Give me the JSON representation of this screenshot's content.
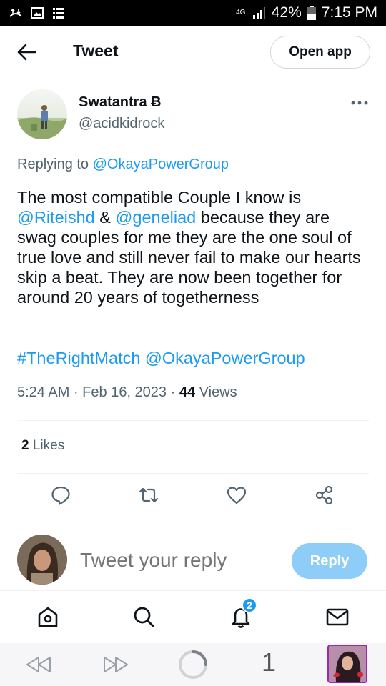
{
  "status_bar": {
    "network": "4G",
    "battery": "42%",
    "time": "7:15 PM"
  },
  "header": {
    "title": "Tweet",
    "open_app_label": "Open app"
  },
  "tweet": {
    "author_name": "Swatantra Ƀ",
    "author_handle": "@acidkidrock",
    "replying_prefix": "Replying to",
    "replying_to": "@OkayaPowerGroup",
    "body_part1": "The most compatible Couple I know is",
    "mention1": "@Riteishd",
    "amp": "&",
    "mention2": "@geneliad",
    "body_part2": "because they are swag couples for me they are the one soul of true love and still never fail to make our hearts skip a beat. They are now been together for around 20 years of togetherness",
    "hashtag": "#TheRightMatch",
    "hashtag_mention": "@OkayaPowerGroup",
    "time": "5:24 AM",
    "date": "Feb 16, 2023",
    "views_count": "44",
    "views_label": "Views",
    "likes_count": "2",
    "likes_label": "Likes"
  },
  "actions": [
    "reply-icon",
    "retweet-icon",
    "like-icon",
    "share-icon"
  ],
  "composer": {
    "placeholder": "Tweet your reply",
    "reply_label": "Reply"
  },
  "bottom_nav": {
    "items": [
      "home-icon",
      "search-icon",
      "notifications-icon",
      "messages-icon"
    ],
    "notification_badge": "2"
  },
  "system_nav": {
    "tab_count": "1"
  },
  "colors": {
    "link": "#1d9bf0",
    "muted": "#536471",
    "reply_button": "#8ecdf8"
  }
}
